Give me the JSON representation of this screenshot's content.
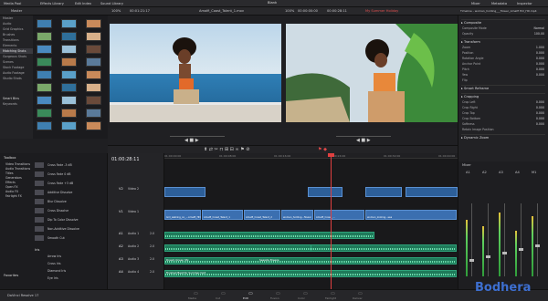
{
  "topbar": {
    "tabs": [
      "Media Pool",
      "Effects Library",
      "Edit Index",
      "Sound Library"
    ],
    "inspector_tabs": [
      "Mixer",
      "Metadata",
      "Inspector"
    ]
  },
  "media": {
    "title": "Master",
    "sidebar_items": [
      "Master",
      "Audio",
      "Grid Graphics",
      "Brushes",
      "Transitions",
      "Elements",
      "Matching Shots",
      "Gorgeous Shots",
      "Scenes",
      "Stock Footage",
      "Audio Footage",
      "Studio Shots"
    ],
    "selected": "Matching Shots",
    "smart_bins_label": "Smart Bins",
    "keywords_label": "Keywords"
  },
  "source_viewer": {
    "zoom": "100%",
    "timecode": "00:01:21:17",
    "clip_name": "Amalfi_Coast_Talent_1.mov"
  },
  "timeline_viewer": {
    "zoom": "100%",
    "name": "Blank",
    "timecode": "00:00:00:00",
    "playhead": "00:00:28:11",
    "label": "My Summer Holiday"
  },
  "inspector": {
    "title": "Timeline - woman_holding___flower_Amalfi Hill_HD.mp4",
    "sections": [
      {
        "name": "Composite",
        "rows": [
          {
            "k": "Composite Mode",
            "v": "Normal"
          },
          {
            "k": "Opacity",
            "v": "100.00"
          }
        ]
      },
      {
        "name": "Transform",
        "rows": [
          {
            "k": "Zoom",
            "v": "1.000"
          },
          {
            "k": "Position",
            "v": "0.000"
          },
          {
            "k": "Rotation Angle",
            "v": "0.000"
          },
          {
            "k": "Anchor Point",
            "v": "0.000"
          },
          {
            "k": "Pitch",
            "v": "0.000"
          },
          {
            "k": "Yaw",
            "v": "0.000"
          },
          {
            "k": "Flip",
            "v": ""
          }
        ]
      },
      {
        "name": "Smart Reframe",
        "rows": []
      },
      {
        "name": "Cropping",
        "rows": [
          {
            "k": "Crop Left",
            "v": "0.000"
          },
          {
            "k": "Crop Right",
            "v": "0.000"
          },
          {
            "k": "Crop Top",
            "v": "0.000"
          },
          {
            "k": "Crop Bottom",
            "v": "0.000"
          },
          {
            "k": "Softness",
            "v": "0.000"
          },
          {
            "k": "Retain Image Position",
            "v": ""
          }
        ]
      },
      {
        "name": "Dynamic Zoom",
        "rows": []
      }
    ]
  },
  "timeline": {
    "timecode": "01:00:28:11",
    "ruler_marks": [
      "01:00:00:00",
      "01:00:08:00",
      "01:00:16:00",
      "01:00:24:00",
      "01:00:32:00",
      "01:00:40:00"
    ],
    "tracks": [
      {
        "id": "V2",
        "name": "Video 2"
      },
      {
        "id": "V1",
        "name": "Video 1"
      },
      {
        "id": "A1",
        "name": "Audio 1",
        "level": "2.0"
      },
      {
        "id": "A2",
        "name": "Audio 2",
        "level": "2.0"
      },
      {
        "id": "A3",
        "name": "Audio 3",
        "level": "2.0"
      },
      {
        "id": "A4",
        "name": "Audio 4",
        "level": "2.0"
      }
    ],
    "v1_clips": [
      "Girl_walking_on_...Amalfi_HD",
      "Amalfi_Coast_Talent_1",
      "Amalfi_Coast_Talent_2",
      "woman_holding...flower",
      "Amalfi_Coast_...",
      "woman_looking...sea"
    ],
    "a_clips": [
      "Dream Ocean Sfx",
      "Seaside Breeze",
      "Finished Beat for Summer.mp3"
    ]
  },
  "effects": {
    "toolbox_label": "Toolbox",
    "items": [
      "Video Transitions",
      "Audio Transitions",
      "Titles",
      "Generators",
      "Effects",
      "Open FX",
      "Audio FX",
      "Fairlight FX"
    ],
    "list": [
      "Cross Fade -3 dB",
      "Cross Fade 0 dB",
      "Cross Fade +3 dB",
      "Additive Dissolve",
      "Blur Dissolve",
      "Cross Dissolve",
      "Dip To Color Dissolve",
      "Non-Additive Dissolve",
      "Smooth Cut"
    ],
    "iris_label": "Iris",
    "iris_list": [
      "Arrow Iris",
      "Cross Iris",
      "Diamond Iris",
      "Eye Iris"
    ],
    "favorites_label": "Favorites"
  },
  "mixer": {
    "title": "Mixer",
    "channels": [
      "A1",
      "A2",
      "A3",
      "A4",
      "M1"
    ],
    "levels": [
      0.62,
      0.55,
      0.7,
      0.5,
      0.66
    ]
  },
  "bottom": {
    "app": "DaVinci Resolve 17",
    "pages": [
      "Media",
      "Cut",
      "Edit",
      "Fusion",
      "Color",
      "Fairlight",
      "Deliver"
    ],
    "active": "Edit"
  },
  "watermark": "Bodhera"
}
